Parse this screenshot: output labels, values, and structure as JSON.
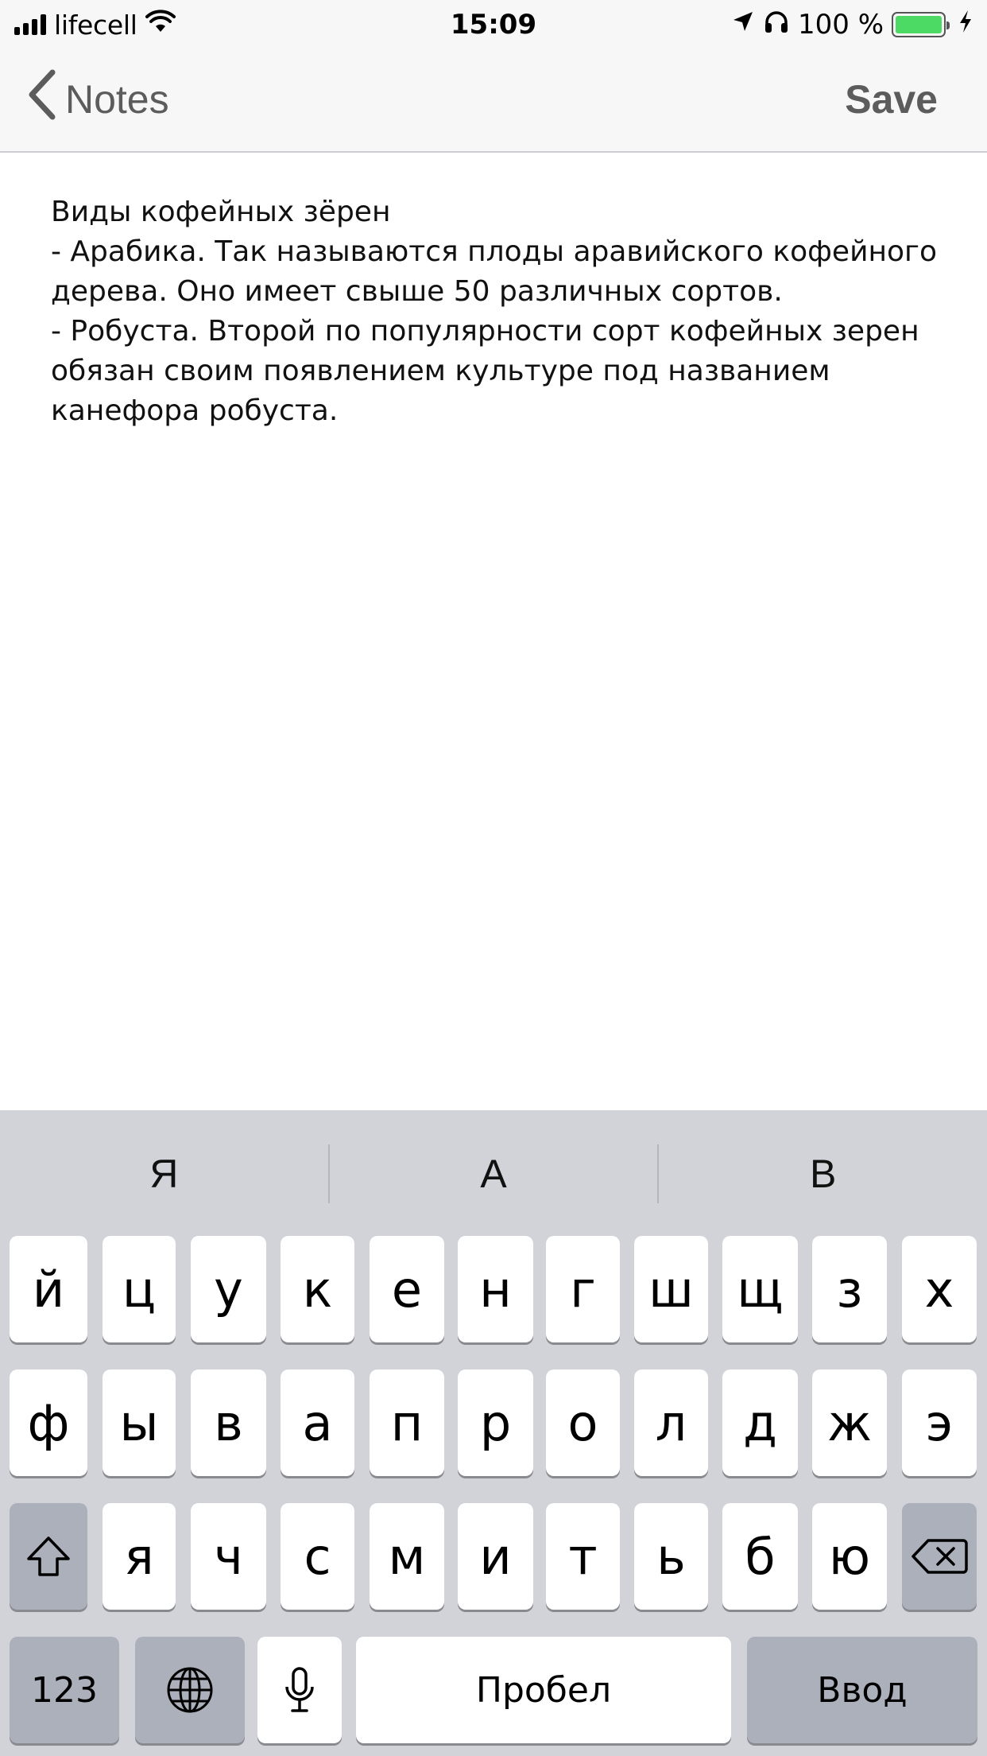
{
  "status_bar": {
    "carrier": "lifecell",
    "time": "15:09",
    "battery_text": "100 %",
    "battery_level": 1.0,
    "icons": [
      "signal-icon",
      "wifi-icon",
      "location-arrow-icon",
      "headphones-icon",
      "battery-icon",
      "charging-bolt-icon"
    ]
  },
  "nav": {
    "back_label": "Notes",
    "save_label": "Save",
    "tint_color": "#5c5c5c"
  },
  "note": {
    "text": "Виды кофейных зёрен\n- Арабика. Так называются плоды аравийского кофейного дерева. Оно имеет свыше 50 различных сортов.\n- Робуста. Второй по популярности сорт кофейных зерен обязан своим появлением культуре под названием канефора робуста."
  },
  "keyboard": {
    "predictions": [
      "Я",
      "А",
      "В"
    ],
    "row1": [
      "й",
      "ц",
      "у",
      "к",
      "е",
      "н",
      "г",
      "ш",
      "щ",
      "з",
      "х"
    ],
    "row2": [
      "ф",
      "ы",
      "в",
      "а",
      "п",
      "р",
      "о",
      "л",
      "д",
      "ж",
      "э"
    ],
    "row3": [
      "я",
      "ч",
      "с",
      "м",
      "и",
      "т",
      "ь",
      "б",
      "ю"
    ],
    "numbers_label": "123",
    "space_label": "Пробел",
    "return_label": "Ввод",
    "key_color": "#ffffff",
    "function_key_color": "#abb0bb",
    "background_color": "#d1d3d9"
  }
}
